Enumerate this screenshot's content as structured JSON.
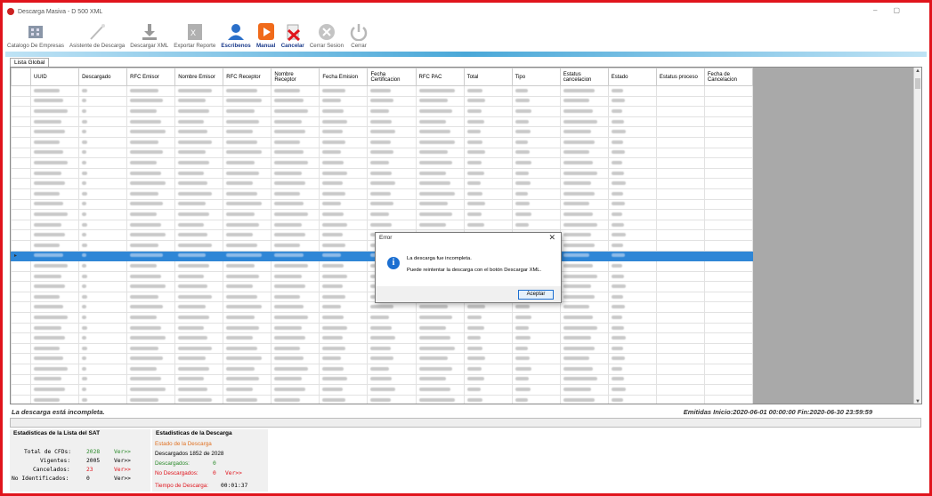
{
  "window": {
    "title": "Descarga Masiva - D 500 XML",
    "min": "–",
    "max": "▢"
  },
  "toolbar": [
    {
      "name": "catalogo-empresas-button",
      "label": "Catalogo De Empresas",
      "icon": "building-icon"
    },
    {
      "name": "asistente-button",
      "label": "Asistente de Descarga",
      "icon": "wand-icon"
    },
    {
      "name": "descargar-xml-button",
      "label": "Descargar XML",
      "icon": "download-icon"
    },
    {
      "name": "exportar-button",
      "label": "Exportar Reporte",
      "icon": "excel-icon"
    },
    {
      "name": "escribenos-button",
      "label": "Escribenos",
      "icon": "user-icon"
    },
    {
      "name": "manual-button",
      "label": "Manual",
      "icon": "play-icon"
    },
    {
      "name": "cancelar-button",
      "label": "Cancelar",
      "icon": "cancel-icon"
    },
    {
      "name": "cerrar-sesion-button",
      "label": "Cerrar Sesion",
      "icon": "x-circle-icon"
    },
    {
      "name": "cerrar-button",
      "label": "Cerrar",
      "icon": "power-icon"
    }
  ],
  "tab": {
    "label": "Lista Global"
  },
  "grid": {
    "columns": [
      "UUID",
      "Descargado",
      "RFC Emisor",
      "Nombre Emisor",
      "RFC Receptor",
      "Nombre Receptor",
      "Fecha Emision",
      "Fecha Certificacion",
      "RFC PAC",
      "Total",
      "Tipo",
      "Estatus cancelacion",
      "Estado",
      "Estatus proceso",
      "Fecha de Cancelacion"
    ],
    "visible_cells": {
      "descargado": "S",
      "tipo": "Ingreso",
      "total_sample": "$77.40",
      "fecha": "2020-06-01"
    },
    "row_count": 32,
    "selected_row": 16
  },
  "dialog": {
    "title": "Error",
    "close": "✕",
    "message_1": "La descarga fue incompleta.",
    "message_2": "Puede reintentar la descarga con el botón Descargar XML.",
    "ok_label": "Aceptar",
    "icon": "info-icon"
  },
  "status": {
    "left": "La descarga está incompleta.",
    "right": "Emitidas Inicio:2020-06-01 00:00:00 Fin:2020-06-30 23:59:59"
  },
  "sat_stats": {
    "title": "Estadisticas de la Lista del SAT",
    "rows": [
      {
        "label": "Total de CFDs:",
        "value": "2028",
        "link": "Ver>>"
      },
      {
        "label": "Vigentes:",
        "value": "2005",
        "link": "Ver>>"
      },
      {
        "label": "Cancelados:",
        "value": "23",
        "link": "Ver>>"
      },
      {
        "label": "No Identificados:",
        "value": "0",
        "link": "Ver>>"
      }
    ]
  },
  "download_stats": {
    "title": "Estadisticas de la Descarga",
    "estado_label": "Estado de la Descarga",
    "descargados_line": "Descargados 1852 de 2028",
    "descargados_label": "Descargados:",
    "descargados_value": "0",
    "no_descargados_label": "No Descargados:",
    "no_descargados_value": "0",
    "no_descargados_link": "Ver>>",
    "tiempo_label": "Tiempo de Descarga:",
    "tiempo_value": "00:01:37"
  }
}
